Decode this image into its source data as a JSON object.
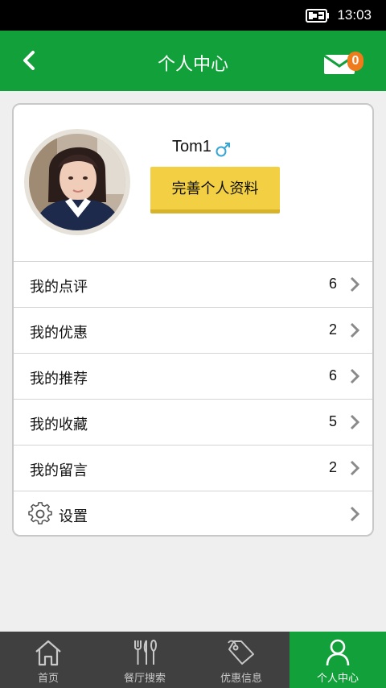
{
  "status": {
    "time": "13:03"
  },
  "header": {
    "title": "个人中心",
    "mail_count": "0"
  },
  "profile": {
    "username": "Tom1",
    "edit_label": "完善个人资料"
  },
  "menu": [
    {
      "label": "我的点评",
      "count": "6"
    },
    {
      "label": "我的优惠",
      "count": "2"
    },
    {
      "label": "我的推荐",
      "count": "6"
    },
    {
      "label": "我的收藏",
      "count": "5"
    },
    {
      "label": "我的留言",
      "count": "2"
    },
    {
      "label": "设置",
      "count": ""
    }
  ],
  "tabs": [
    {
      "label": "首页",
      "icon": "home-icon"
    },
    {
      "label": "餐厅搜索",
      "icon": "fork-knife-icon"
    },
    {
      "label": "优惠信息",
      "icon": "tag-icon"
    },
    {
      "label": "个人中心",
      "icon": "person-icon",
      "active": true
    }
  ],
  "colors": {
    "primary": "#12a03a",
    "button": "#f2cf43",
    "badge": "#f07b1a",
    "tabbar": "#404040"
  }
}
